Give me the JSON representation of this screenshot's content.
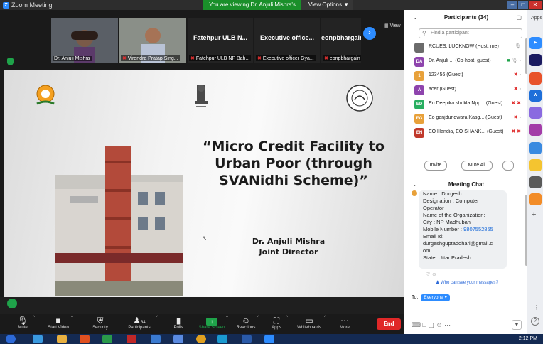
{
  "window": {
    "title": "Zoom Meeting",
    "viewing_banner": "You are viewing Dr. Anjuli Mishra's screen",
    "view_options": "View Options"
  },
  "strip": {
    "tiles": [
      {
        "name": "Dr. Anjuli Mishra",
        "big": ""
      },
      {
        "name": "Virendra Pratap Sing...",
        "big": ""
      },
      {
        "name": "Fatehpur ULB NP Bah...",
        "big": "Fatehpur ULB N..."
      },
      {
        "name": "Executive officer Gya...",
        "big": "Executive office..."
      },
      {
        "name": "eonpbhargain",
        "big": "eonpbhargain"
      }
    ],
    "view_label": "View"
  },
  "slide": {
    "title_lines": [
      "“Micro Credit Facility to",
      "Urban Poor (through",
      "SVANidhi Scheme)”"
    ],
    "presenter_name": "Dr. Anjuli Mishra",
    "presenter_role": "Joint Director"
  },
  "toolbar": {
    "mute": "Mute",
    "start_video": "Start Video",
    "security": "Security",
    "participants": "Participants",
    "participants_count": "34",
    "polls": "Polls",
    "share_screen": "Share Screen",
    "reactions": "Reactions",
    "apps": "Apps",
    "whiteboards": "Whiteboards",
    "more": "More",
    "end": "End"
  },
  "participants": {
    "header": "Participants (34)",
    "search_placeholder": "Find a participant",
    "rows": [
      {
        "initials": "",
        "name": "RCUES, LUCKNOW (Host, me)",
        "color": "#6b6b6b"
      },
      {
        "initials": "DA",
        "name": "Dr. Anjuli ... (Co-host, guest)",
        "color": "#8e44ad"
      },
      {
        "initials": "1",
        "name": "123456 (Guest)",
        "color": "#e8a13a"
      },
      {
        "initials": "A",
        "name": "acer (Guest)",
        "color": "#8e44ad"
      },
      {
        "initials": "ED",
        "name": "Eo Deepika shukla Npp... (Guest)",
        "color": "#27ae60"
      },
      {
        "initials": "EG",
        "name": "Eo ganjdundwara,Kasg... (Guest)",
        "color": "#e8a13a"
      },
      {
        "initials": "EH",
        "name": "EO Handia,  EO SHANK... (Guest)",
        "color": "#c0392b"
      }
    ],
    "invite": "Invite",
    "mute_all": "Mute All",
    "more": "..."
  },
  "chat": {
    "header": "Meeting Chat",
    "lines": [
      "Name : Durgesh",
      "Designation : Computer",
      "Operator",
      "Name of the Organization:",
      "City : NP Madhuban",
      "Mobile Number : ",
      "Email Id:",
      "durgeshguptadohari@gmail.c",
      "om",
      "State :Uttar Pradesh"
    ],
    "phone": "9807552855",
    "who_can_see": "Who can see your messages?",
    "to_label": "To:",
    "to_value": "Everyone"
  },
  "apps_sidebar": {
    "header": "Apps"
  },
  "taskbar": {
    "clock": "2:12 PM"
  }
}
